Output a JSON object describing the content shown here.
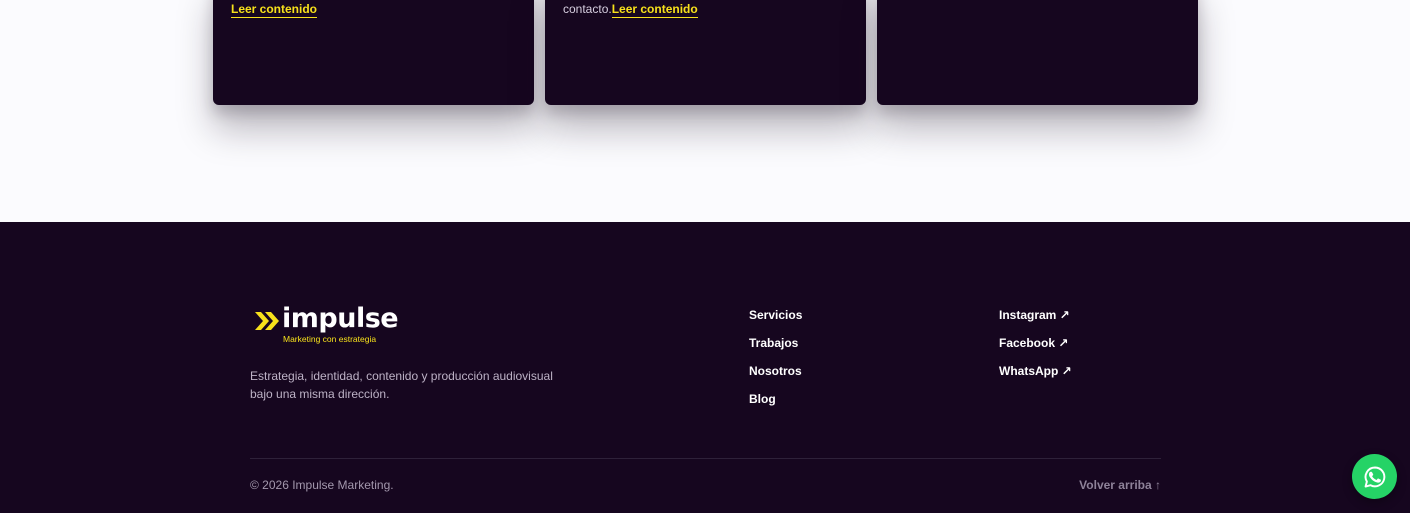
{
  "cards": [
    {
      "pre_text": "",
      "link_label": "Leer contenido"
    },
    {
      "pre_text": "contacto.",
      "link_label": "Leer contenido"
    },
    {
      "pre_text": "",
      "link_label": ""
    }
  ],
  "footer": {
    "brand": {
      "wordmark": "impulse",
      "tagline": "Marketing con estrategia"
    },
    "description": "Estrategia, identidad, contenido y producción audiovisual bajo una misma dirección.",
    "nav_links": [
      "Servicios",
      "Trabajos",
      "Nosotros",
      "Blog"
    ],
    "social_links": [
      "Instagram ↗",
      "Facebook ↗",
      "WhatsApp ↗"
    ],
    "copyright": "© 2026 Impulse Marketing.",
    "back_to_top": "Volver arriba ↑"
  },
  "colors": {
    "background_light": "#fbfbfe",
    "dark_purple": "#16061f",
    "accent_yellow": "#f7e11b",
    "whatsapp_green": "#25d366"
  },
  "icons": {
    "brand_mark": "double-chevron-right-icon",
    "floating_button": "whatsapp-icon"
  }
}
